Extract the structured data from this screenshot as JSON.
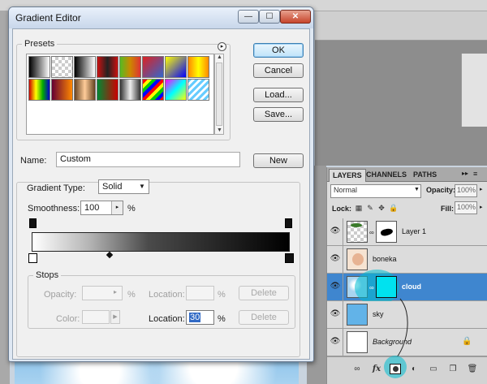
{
  "gradient_editor": {
    "title": "Gradient Editor",
    "window_buttons": {
      "minimize": "—",
      "maximize": "☐",
      "close": "✕"
    },
    "presets_label": "Presets",
    "buttons": {
      "ok": "OK",
      "cancel": "Cancel",
      "load": "Load...",
      "save": "Save...",
      "new": "New"
    },
    "name_label": "Name:",
    "name_value": "Custom",
    "gradient_type_label": "Gradient Type:",
    "gradient_type_value": "Solid",
    "smoothness_label": "Smoothness:",
    "smoothness_value": "100",
    "percent": "%",
    "stops_label": "Stops",
    "opacity_label": "Opacity:",
    "location_label": "Location:",
    "color_label": "Color:",
    "location_value": "30",
    "delete_label": "Delete",
    "gradient_colors": {
      "start": "#ffffff",
      "end": "#000000"
    }
  },
  "layers_panel": {
    "tabs": [
      "LAYERS",
      "CHANNELS",
      "PATHS"
    ],
    "blend_mode": "Normal",
    "opacity_label": "Opacity:",
    "opacity_value": "100%",
    "lock_label": "Lock:",
    "fill_label": "Fill:",
    "fill_value": "100%",
    "layers": [
      {
        "name": "Layer 1"
      },
      {
        "name": "boneka"
      },
      {
        "name": "cloud",
        "selected": true
      },
      {
        "name": "sky"
      },
      {
        "name": "Background",
        "locked": true
      }
    ],
    "bottom_icons": [
      "link-icon",
      "fx-icon",
      "layer-mask-icon",
      "adjustment-layer-icon",
      "group-folder-icon",
      "new-layer-icon",
      "trash-icon"
    ],
    "highlight_color": "#00c8dc"
  }
}
